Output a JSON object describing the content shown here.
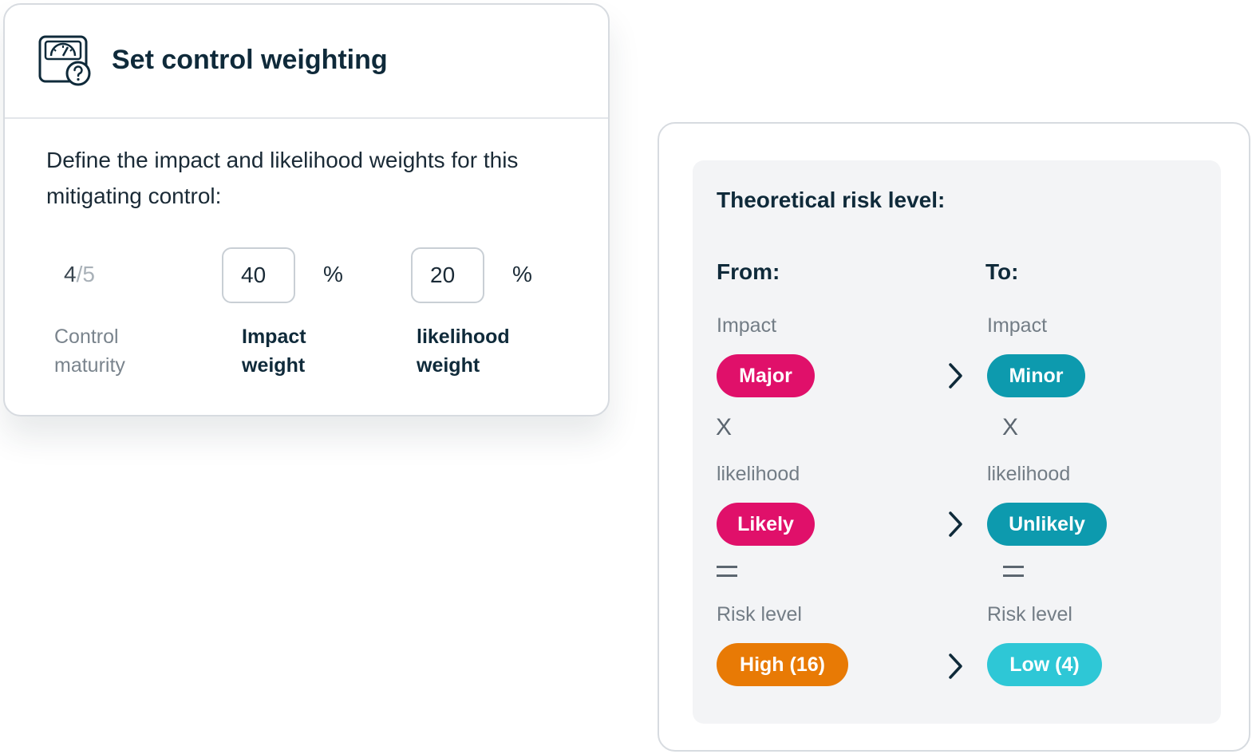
{
  "control_card": {
    "title": "Set control weighting",
    "description": "Define the impact and likelihood weights for this mitigating control:",
    "maturity": {
      "value": "4",
      "separator": "/",
      "total": "5",
      "label_line1": "Control",
      "label_line2": "maturity"
    },
    "impact_weight": {
      "value": "40",
      "unit": "%",
      "label_line1": "Impact",
      "label_line2": "weight"
    },
    "likelihood_weight": {
      "value": "20",
      "unit": "%",
      "label_line1": "likelihood",
      "label_line2": "weight"
    },
    "icon": "gauge-question-icon"
  },
  "risk_card": {
    "title": "Theoretical risk level:",
    "from": {
      "heading": "From:",
      "impact_label": "Impact",
      "impact_value": "Major",
      "multiply": "X",
      "likelihood_label": "likelihood",
      "likelihood_value": "Likely",
      "risk_label": "Risk level",
      "risk_value": "High (16)"
    },
    "to": {
      "heading": "To:",
      "impact_label": "Impact",
      "impact_value": "Minor",
      "multiply": "X",
      "likelihood_label": "likelihood",
      "likelihood_value": "Unlikely",
      "risk_label": "Risk level",
      "risk_value": "Low (4)"
    },
    "colors": {
      "from_pill": "#e0106a",
      "to_pill": "#0d9aae",
      "high_pill": "#e87a05",
      "low_pill": "#2ec7d6"
    }
  }
}
